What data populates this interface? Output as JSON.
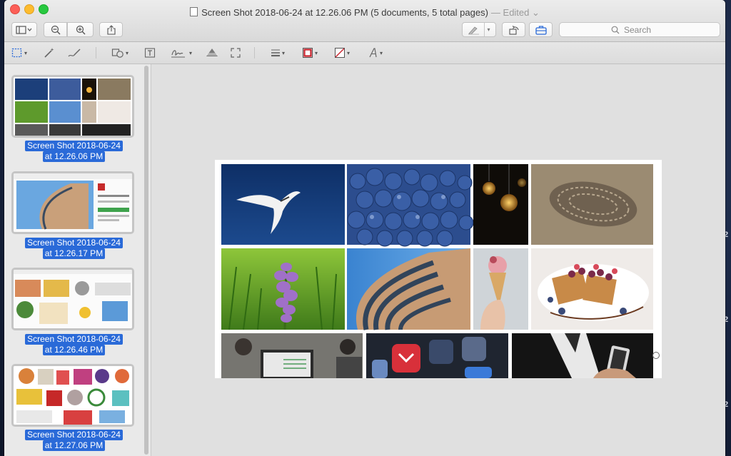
{
  "window": {
    "title": "Screen Shot 2018-06-24 at 12.26.06 PM (5 documents, 5 total pages)",
    "edited_label": "— Edited ⌄"
  },
  "toolbar": {
    "search_placeholder": "Search"
  },
  "sidebar": {
    "items": [
      {
        "line1": "Screen Shot 2018-06-24",
        "line2": "at 12.26.06 PM"
      },
      {
        "line1": "Screen Shot 2018-06-24",
        "line2": "at 12.26.17 PM"
      },
      {
        "line1": "Screen Shot 2018-06-24",
        "line2": "at 12.26.46 PM"
      },
      {
        "line1": "Screen Shot 2018-06-24",
        "line2": "at 12.27.06 PM"
      }
    ]
  },
  "desktop": {
    "side_numbers": [
      "2",
      "2",
      "2"
    ]
  },
  "colors": {
    "selection": "#2a6ad8",
    "red_swatch": "#c8202a"
  }
}
